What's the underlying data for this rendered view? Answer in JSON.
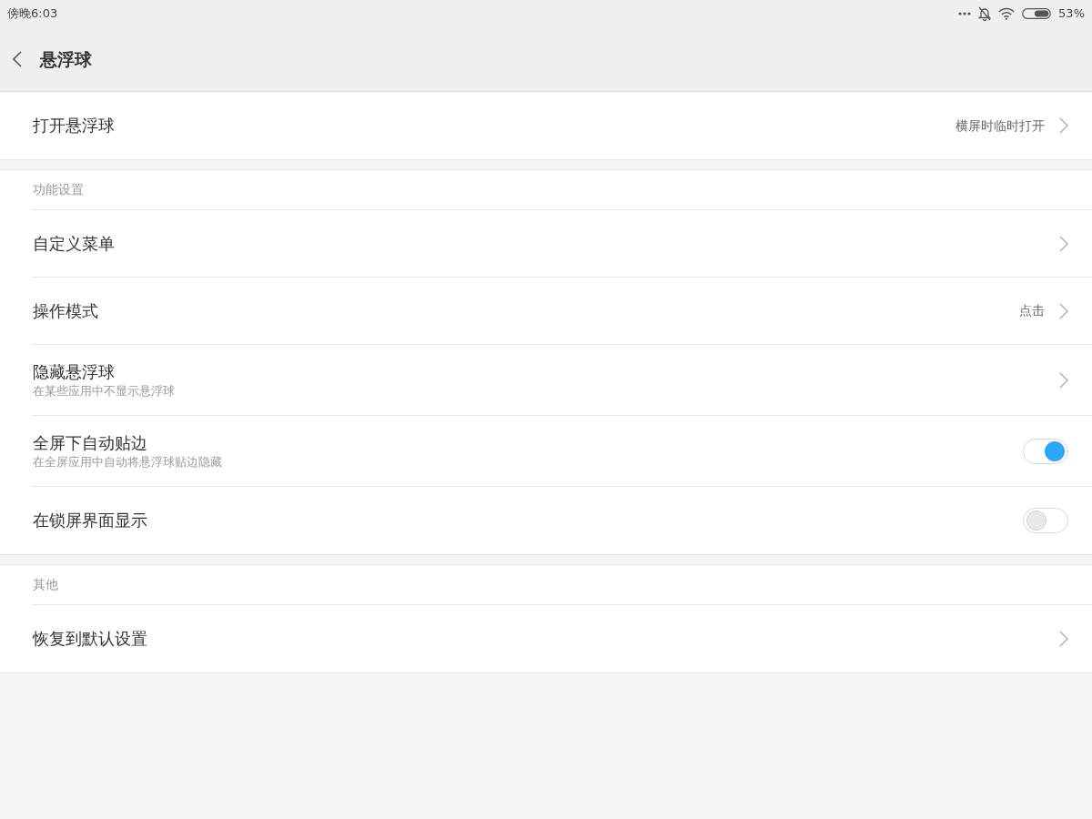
{
  "status_bar": {
    "time": "傍晚6:03",
    "battery": "53%"
  },
  "header": {
    "title": "悬浮球"
  },
  "sections": [
    {
      "rows": [
        {
          "kind": "link",
          "title": "打开悬浮球",
          "value": "横屏时临时打开"
        }
      ]
    },
    {
      "heading": "功能设置",
      "rows": [
        {
          "kind": "link",
          "title": "自定义菜单"
        },
        {
          "kind": "link",
          "title": "操作模式",
          "value": "点击"
        },
        {
          "kind": "link",
          "title": "隐藏悬浮球",
          "subtitle": "在某些应用中不显示悬浮球"
        },
        {
          "kind": "toggle",
          "title": "全屏下自动贴边",
          "subtitle": "在全屏应用中自动将悬浮球贴边隐藏",
          "on": true
        },
        {
          "kind": "toggle",
          "title": "在锁屏界面显示",
          "on": false
        }
      ]
    },
    {
      "heading": "其他",
      "rows": [
        {
          "kind": "link",
          "title": "恢复到默认设置"
        }
      ]
    }
  ]
}
